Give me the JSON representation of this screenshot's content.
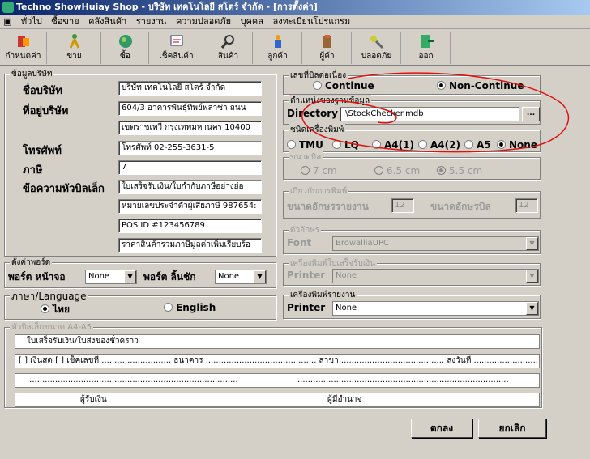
{
  "window": {
    "title": "Techno ShowHuiay Shop - บริษัท เทคโนโลยี สโตร์ จำกัด - [การตั้งค่า]"
  },
  "menu": [
    "ทั่วไป",
    "ซื้อขาย",
    "คลังสินค้า",
    "รายงาน",
    "ความปลอดภัย",
    "บุคคล",
    "ลงทะเบียนโปรแกรม"
  ],
  "toolbar": [
    "กำหนดค่า",
    "ขาย",
    "ซื้อ",
    "เช็คสินค้า",
    "สินค้า",
    "ลูกค้า",
    "ผู้ค้า",
    "ปลอดภัย",
    "ออก"
  ],
  "company": {
    "group": "ข้อมูลบริษัท",
    "name_label": "ชื่อบริษัท",
    "name": "บริษัท เทคโนโลยี สโตร์ จำกัด",
    "addr_label": "ที่อยู่บริษัท",
    "addr1": "604/3 อาคารพันธุ์ทิพย์พลาซ่า ถนน",
    "addr2": "เขตราชเทวี กรุงเทพมหานคร 10400",
    "phone_label": "โทรศัพท์",
    "phone": "โทรศัพท์ 02-255-3631-5",
    "tax_label": "ภาษี",
    "tax": "7",
    "header_label": "ข้อความหัวบิลเล็ก",
    "header1": "ใบเสร็จรับเงิน/ใบกำกับภาษีอย่างย่อ",
    "header2": "หมายเลขประจำตัวผู้เสียภาษี 987654:",
    "header3": "POS ID #123456789",
    "header4": "ราคาสินค้ารวมภาษีมูลค่าเพิ่มเรียบร้อ"
  },
  "ports": {
    "group": "ตั้งค่าพอร์ต",
    "screen_label": "พอร์ต หน้าจอ",
    "screen": "None",
    "drawer_label": "พอร์ต ลิ้นชัก",
    "drawer": "None"
  },
  "language": {
    "group": "ภาษา/Language",
    "thai": "ไทย",
    "english": "English"
  },
  "bill": {
    "group": "เลขที่บิลต่อเนื่อง",
    "continue": "Continue",
    "noncontinue": "Non-Continue"
  },
  "db": {
    "group": "ตำแหน่งของฐานข้อมูล",
    "label": "Directory",
    "value": ".\\StockChecker.mdb",
    "browse": "..."
  },
  "printer_type": {
    "group": "ชนิดเครื่องพิมพ์",
    "opts": [
      "TMU",
      "LQ",
      "A4(1)",
      "A4(2)",
      "A5",
      "None"
    ]
  },
  "paper": {
    "group": "ขนาดบิล",
    "opts": [
      "7 cm",
      "6.5 cm",
      "5.5 cm"
    ]
  },
  "fontsize": {
    "group": "เกี่ยวกับการพิมพ์",
    "report_label": "ขนาดอักษรรายงาน",
    "report": "12",
    "bill_label": "ขนาดอักษรบิล",
    "bill": "12"
  },
  "fontgrp": {
    "group": "ตัวอักษร",
    "label": "Font",
    "value": "BrowalliaUPC"
  },
  "receipt_printer": {
    "group": "เครื่องพิมพ์ใบเสร็จรับเงิน",
    "label": "Printer",
    "value": "None"
  },
  "report_printer": {
    "group": "เครื่องพิมพ์รายงาน",
    "label": "Printer",
    "value": "None"
  },
  "a4": {
    "group": "หัวบิลเล็กขนาด A4-A5",
    "line1": "ใบเสร็จรับเงิน/ใบส่งของชั่วคราว",
    "line2": "[  ] เงินสด  [  ] เช็คเลขที่ ........................... ธนาคาร ........................................... สาขา ........................................ ลงวันที่ ..........................",
    "line3": "..................................................................................",
    "line3b": "..................................................................................",
    "line4a": "ผู้รับเงิน",
    "line4b": "ผู้มีอำนาจ"
  },
  "buttons": {
    "ok": "ตกลง",
    "cancel": "ยกเลิก"
  }
}
